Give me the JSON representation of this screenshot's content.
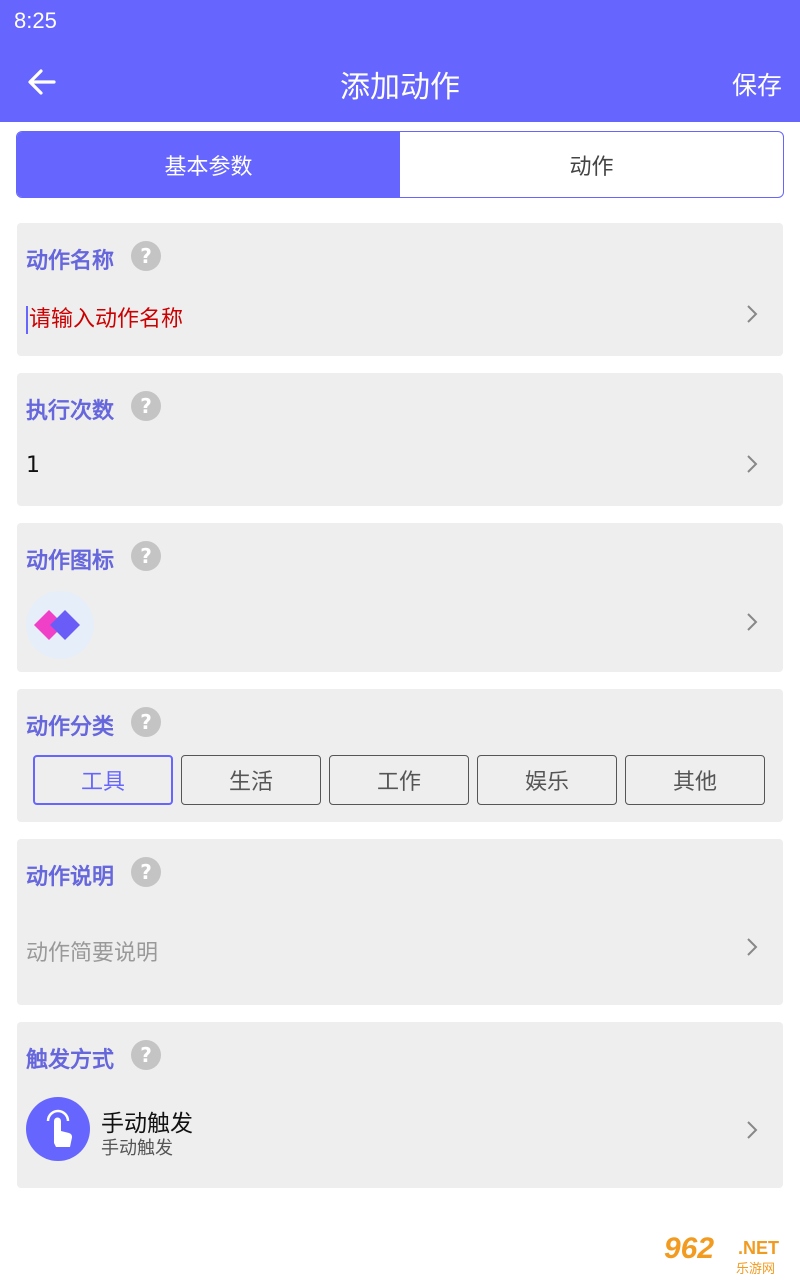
{
  "status_bar": {
    "time": "8:25"
  },
  "app_bar": {
    "title": "添加动作",
    "save_label": "保存",
    "back_icon": "arrow-left-icon"
  },
  "tabs": [
    {
      "label": "基本参数",
      "active": true
    },
    {
      "label": "动作",
      "active": false
    }
  ],
  "fields": {
    "name": {
      "label": "动作名称",
      "help": "?",
      "placeholder": "请输入动作名称"
    },
    "count": {
      "label": "执行次数",
      "help": "?",
      "value": "1"
    },
    "icon": {
      "label": "动作图标",
      "help": "?"
    },
    "category": {
      "label": "动作分类",
      "help": "?",
      "options": [
        "工具",
        "生活",
        "工作",
        "娱乐",
        "其他"
      ],
      "selected": "工具"
    },
    "description": {
      "label": "动作说明",
      "help": "?",
      "placeholder": "动作简要说明"
    },
    "trigger": {
      "label": "触发方式",
      "help": "?",
      "title": "手动触发",
      "subtitle": "手动触发"
    }
  },
  "watermark": {
    "brand": "962",
    "suffix": ".NET",
    "cn": "乐游网"
  },
  "colors": {
    "primary": "#6666ff",
    "card_bg": "#eeeeee",
    "placeholder_red": "#cc0000"
  }
}
